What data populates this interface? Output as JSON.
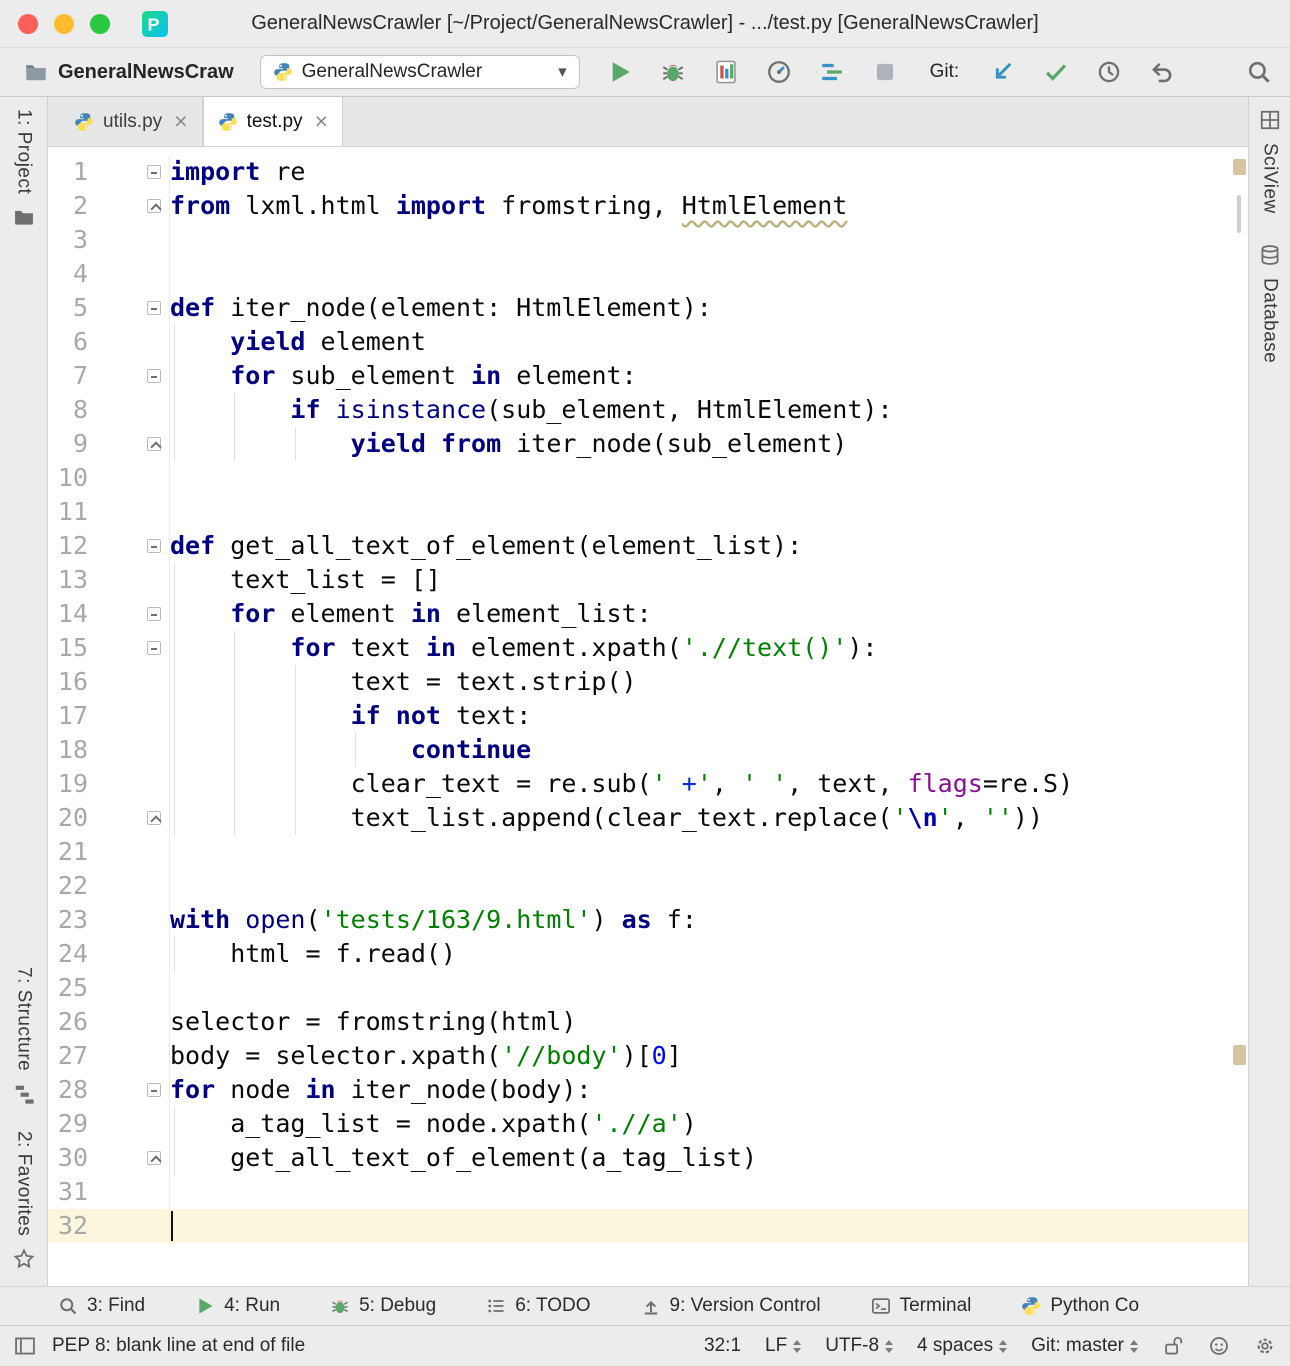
{
  "colors": {
    "keyword": "#000080",
    "string": "#008000",
    "number": "#0000ff",
    "named_arg": "#871094",
    "caret_line_bg": "#fcf6dd",
    "run_green": "#59a869",
    "update_blue": "#3592c4",
    "chrome_bg": "#ececec"
  },
  "title_bar": {
    "title": "GeneralNewsCrawler [~/Project/GeneralNewsCrawler] - .../test.py [GeneralNewsCrawler]"
  },
  "toolbar": {
    "project_name": "GeneralNewsCraw",
    "run_config": "GeneralNewsCrawler",
    "git_label": "Git:"
  },
  "tab_bar": {
    "tabs": [
      {
        "label": "utils.py",
        "active": false
      },
      {
        "label": "test.py",
        "active": true
      }
    ]
  },
  "left_stripe": {
    "project": "1: Project",
    "structure": "7: Structure",
    "favorites": "2: Favorites"
  },
  "right_stripe": {
    "sciview": "SciView",
    "database": "Database"
  },
  "editor": {
    "current_line": 32,
    "cursor_col": 0,
    "fold_starts": [
      1,
      5,
      7,
      12,
      14,
      15,
      28
    ],
    "fold_ends": [
      2,
      9,
      20,
      30
    ],
    "lines": [
      {
        "n": 1,
        "tokens": [
          {
            "c": "kw",
            "t": "import"
          },
          {
            "c": "p",
            "t": " re"
          }
        ]
      },
      {
        "n": 2,
        "tokens": [
          {
            "c": "kw",
            "t": "from"
          },
          {
            "c": "p",
            "t": " lxml.html "
          },
          {
            "c": "kw",
            "t": "import"
          },
          {
            "c": "p",
            "t": " fromstring, "
          },
          {
            "c": "typo",
            "t": "HtmlElement"
          }
        ]
      },
      {
        "n": 3,
        "tokens": []
      },
      {
        "n": 4,
        "tokens": []
      },
      {
        "n": 5,
        "tokens": [
          {
            "c": "kw",
            "t": "def"
          },
          {
            "c": "p",
            "t": " iter_node(element: HtmlElement):"
          }
        ]
      },
      {
        "n": 6,
        "tokens": [
          {
            "c": "p",
            "t": "    "
          },
          {
            "c": "kw",
            "t": "yield"
          },
          {
            "c": "p",
            "t": " element"
          }
        ]
      },
      {
        "n": 7,
        "tokens": [
          {
            "c": "p",
            "t": "    "
          },
          {
            "c": "kw",
            "t": "for"
          },
          {
            "c": "p",
            "t": " sub_element "
          },
          {
            "c": "kw",
            "t": "in"
          },
          {
            "c": "p",
            "t": " element:"
          }
        ]
      },
      {
        "n": 8,
        "tokens": [
          {
            "c": "p",
            "t": "        "
          },
          {
            "c": "kw",
            "t": "if"
          },
          {
            "c": "p",
            "t": " "
          },
          {
            "c": "bi",
            "t": "isinstance"
          },
          {
            "c": "p",
            "t": "(sub_element, HtmlElement):"
          }
        ]
      },
      {
        "n": 9,
        "tokens": [
          {
            "c": "p",
            "t": "            "
          },
          {
            "c": "kw",
            "t": "yield"
          },
          {
            "c": "p",
            "t": " "
          },
          {
            "c": "kw",
            "t": "from"
          },
          {
            "c": "p",
            "t": " iter_node(sub_element)"
          }
        ]
      },
      {
        "n": 10,
        "tokens": []
      },
      {
        "n": 11,
        "tokens": []
      },
      {
        "n": 12,
        "tokens": [
          {
            "c": "kw",
            "t": "def"
          },
          {
            "c": "p",
            "t": " get_all_text_of_element(element_list):"
          }
        ]
      },
      {
        "n": 13,
        "tokens": [
          {
            "c": "p",
            "t": "    text_list = []"
          }
        ]
      },
      {
        "n": 14,
        "tokens": [
          {
            "c": "p",
            "t": "    "
          },
          {
            "c": "kw",
            "t": "for"
          },
          {
            "c": "p",
            "t": " element "
          },
          {
            "c": "kw",
            "t": "in"
          },
          {
            "c": "p",
            "t": " element_list:"
          }
        ]
      },
      {
        "n": 15,
        "tokens": [
          {
            "c": "p",
            "t": "        "
          },
          {
            "c": "kw",
            "t": "for"
          },
          {
            "c": "p",
            "t": " text "
          },
          {
            "c": "kw",
            "t": "in"
          },
          {
            "c": "p",
            "t": " element.xpath("
          },
          {
            "c": "s",
            "t": "'.//text()'"
          },
          {
            "c": "p",
            "t": "):"
          }
        ]
      },
      {
        "n": 16,
        "tokens": [
          {
            "c": "p",
            "t": "            text = text.strip()"
          }
        ]
      },
      {
        "n": 17,
        "tokens": [
          {
            "c": "p",
            "t": "            "
          },
          {
            "c": "kw",
            "t": "if"
          },
          {
            "c": "p",
            "t": " "
          },
          {
            "c": "kw",
            "t": "not"
          },
          {
            "c": "p",
            "t": " text:"
          }
        ]
      },
      {
        "n": 18,
        "tokens": [
          {
            "c": "p",
            "t": "                "
          },
          {
            "c": "kw",
            "t": "continue"
          }
        ]
      },
      {
        "n": 19,
        "tokens": [
          {
            "c": "p",
            "t": "            clear_text = re.sub("
          },
          {
            "c": "s",
            "t": "' "
          },
          {
            "c": "re",
            "t": "+"
          },
          {
            "c": "s",
            "t": "'"
          },
          {
            "c": "p",
            "t": ", "
          },
          {
            "c": "s",
            "t": "' '"
          },
          {
            "c": "p",
            "t": ", text, "
          },
          {
            "c": "kwarg",
            "t": "flags"
          },
          {
            "c": "p",
            "t": "=re.S)"
          }
        ]
      },
      {
        "n": 20,
        "tokens": [
          {
            "c": "p",
            "t": "            text_list.append(clear_text.replace("
          },
          {
            "c": "s",
            "t": "'"
          },
          {
            "c": "esc",
            "t": "\\n"
          },
          {
            "c": "s",
            "t": "'"
          },
          {
            "c": "p",
            "t": ", "
          },
          {
            "c": "s",
            "t": "''"
          },
          {
            "c": "p",
            "t": "))"
          }
        ]
      },
      {
        "n": 21,
        "tokens": []
      },
      {
        "n": 22,
        "tokens": []
      },
      {
        "n": 23,
        "tokens": [
          {
            "c": "kw",
            "t": "with"
          },
          {
            "c": "p",
            "t": " "
          },
          {
            "c": "bi",
            "t": "open"
          },
          {
            "c": "p",
            "t": "("
          },
          {
            "c": "s",
            "t": "'tests/163/9.html'"
          },
          {
            "c": "p",
            "t": ") "
          },
          {
            "c": "kw",
            "t": "as"
          },
          {
            "c": "p",
            "t": " f:"
          }
        ]
      },
      {
        "n": 24,
        "tokens": [
          {
            "c": "p",
            "t": "    html = f.read()"
          }
        ]
      },
      {
        "n": 25,
        "tokens": []
      },
      {
        "n": 26,
        "tokens": [
          {
            "c": "p",
            "t": "selector = fromstring(html)"
          }
        ]
      },
      {
        "n": 27,
        "tokens": [
          {
            "c": "p",
            "t": "body = selector.xpath("
          },
          {
            "c": "s",
            "t": "'//body'"
          },
          {
            "c": "p",
            "t": ")["
          },
          {
            "c": "n",
            "t": "0"
          },
          {
            "c": "p",
            "t": "]"
          }
        ]
      },
      {
        "n": 28,
        "tokens": [
          {
            "c": "kw",
            "t": "for"
          },
          {
            "c": "p",
            "t": " node "
          },
          {
            "c": "kw",
            "t": "in"
          },
          {
            "c": "p",
            "t": " iter_node(body):"
          }
        ]
      },
      {
        "n": 29,
        "tokens": [
          {
            "c": "p",
            "t": "    a_tag_list = node.xpath("
          },
          {
            "c": "s",
            "t": "'.//a'"
          },
          {
            "c": "p",
            "t": ")"
          }
        ]
      },
      {
        "n": 30,
        "tokens": [
          {
            "c": "p",
            "t": "    get_all_text_of_element(a_tag_list)"
          }
        ]
      },
      {
        "n": 31,
        "tokens": []
      },
      {
        "n": 32,
        "tokens": []
      }
    ]
  },
  "bottom_bar": {
    "items": [
      {
        "label": "3: Find",
        "icon": "find"
      },
      {
        "label": "4: Run",
        "icon": "run"
      },
      {
        "label": "5: Debug",
        "icon": "debug"
      },
      {
        "label": "6: TODO",
        "icon": "todo"
      },
      {
        "label": "9: Version Control",
        "icon": "vcs"
      },
      {
        "label": "Terminal",
        "icon": "terminal"
      },
      {
        "label": "Python Co",
        "icon": "python"
      }
    ]
  },
  "status_bar": {
    "message": "PEP 8: blank line at end of file",
    "caret_position": "32:1",
    "line_separator": "LF",
    "encoding": "UTF-8",
    "indent": "4 spaces",
    "git_branch": "Git: master"
  }
}
